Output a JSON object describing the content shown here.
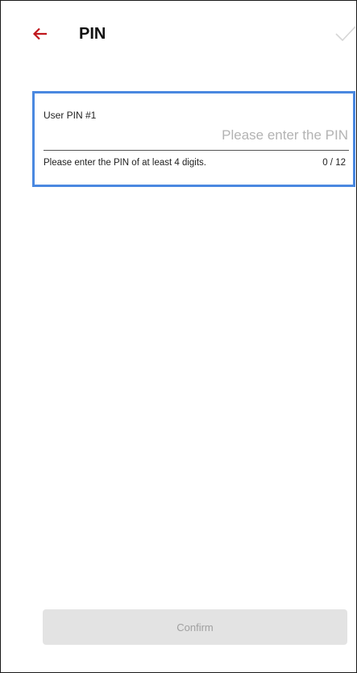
{
  "header": {
    "title": "PIN",
    "back_icon": "arrow-left-icon",
    "confirm_icon": "checkmark-icon",
    "accent_color": "#c0171d"
  },
  "pin_field": {
    "label": "User PIN #1",
    "value": "",
    "placeholder": "Please enter the PIN",
    "helper": "Please enter the PIN of at least 4 digits.",
    "counter": "0 / 12",
    "focus_color": "#4a88e0"
  },
  "footer": {
    "confirm_label": "Confirm"
  }
}
